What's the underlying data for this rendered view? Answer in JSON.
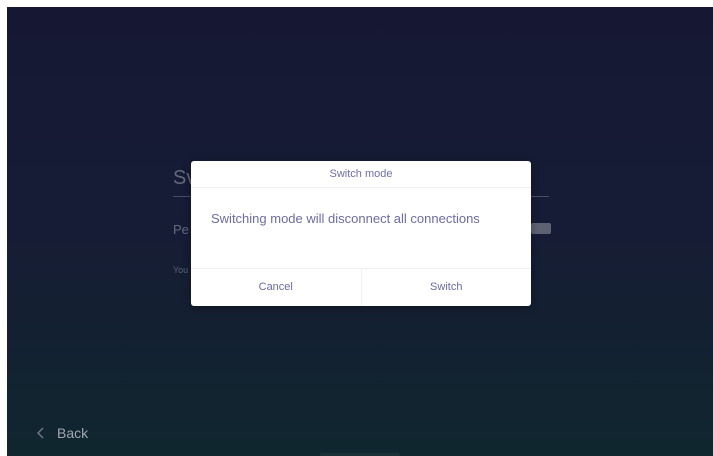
{
  "background": {
    "title_partial": "Sv",
    "row_label_partial": "Pe",
    "description_partial": "You"
  },
  "nav": {
    "back_label": "Back",
    "back_icon": "chevron-left-icon"
  },
  "dialog": {
    "title": "Switch mode",
    "message": "Switching mode will disconnect all connections",
    "cancel_label": "Cancel",
    "confirm_label": "Switch"
  },
  "colors": {
    "background_top": "#1b1e3f",
    "background_bottom": "#14303a",
    "dialog_text": "#6c6aa8"
  }
}
